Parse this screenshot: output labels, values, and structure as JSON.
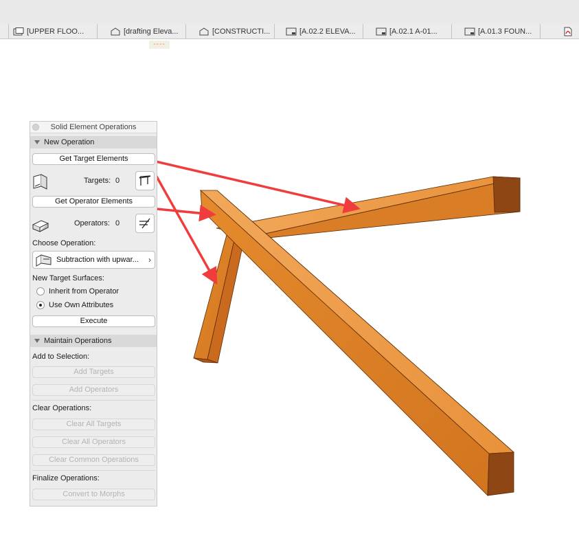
{
  "tabs": [
    {
      "label": "[UPPER FLOO...",
      "icon": "floor-plan-icon"
    },
    {
      "label": "[drafting Eleva...",
      "icon": "house-icon"
    },
    {
      "label": "[CONSTRUCTI...",
      "icon": "house-icon"
    },
    {
      "label": "[A.02.2 ELEVA...",
      "icon": "layout-icon"
    },
    {
      "label": "[A.02.1 A-01...",
      "icon": "layout-icon"
    },
    {
      "label": "[A.01.3 FOUN...",
      "icon": "layout-icon"
    },
    {
      "label": "",
      "icon": "pdf-icon"
    }
  ],
  "tab_indicator": "----",
  "palette": {
    "title": "Solid Element Operations",
    "new_operation": {
      "header": "New Operation",
      "get_targets": "Get Target Elements",
      "targets_label": "Targets:",
      "targets_count": "0",
      "get_operators": "Get Operator Elements",
      "operators_label": "Operators:",
      "operators_count": "0",
      "choose_label": "Choose Operation:",
      "operation_value": "Subtraction with upwar...",
      "surfaces_label": "New Target Surfaces:",
      "radio_inherit": "Inherit from Operator",
      "radio_own": "Use Own Attributes",
      "radio_selected": "Use Own Attributes",
      "execute": "Execute"
    },
    "maintain": {
      "header": "Maintain Operations",
      "add_label": "Add to Selection:",
      "add_targets": "Add Targets",
      "add_operators": "Add Operators",
      "clear_label": "Clear Operations:",
      "clear_targets": "Clear All Targets",
      "clear_operators": "Clear All Operators",
      "clear_common": "Clear Common Operations",
      "finalize_label": "Finalize Operations:",
      "convert": "Convert to Morphs"
    }
  },
  "colors": {
    "arrow": "#f03c3c",
    "wood_light": "#f0a04a",
    "wood_mid": "#e48a2a",
    "wood_dark": "#c0621a",
    "wood_end": "#8a4212"
  }
}
